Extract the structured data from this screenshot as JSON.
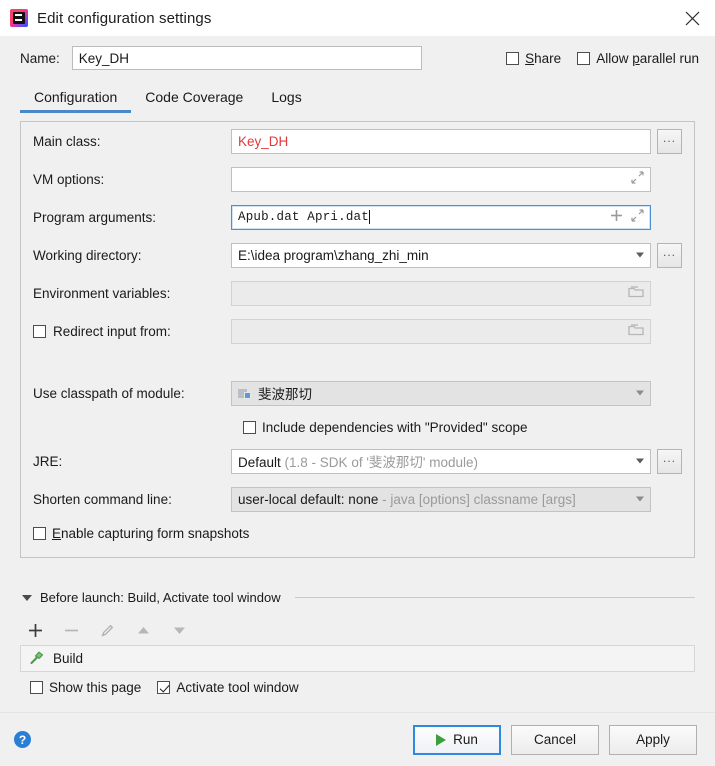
{
  "window": {
    "title": "Edit configuration settings",
    "app_icon": "intellij-idea-icon",
    "close_icon": "close-icon"
  },
  "header": {
    "name_label": "Name:",
    "name_value": "Key_DH",
    "name_placeholder": "",
    "share_label": "Share",
    "share_checked": false,
    "parallel_label": "Allow parallel run",
    "parallel_checked": false
  },
  "tabs": [
    {
      "label": "Configuration",
      "active": true
    },
    {
      "label": "Code Coverage",
      "active": false
    },
    {
      "label": "Logs",
      "active": false
    }
  ],
  "form": {
    "main_class": {
      "label": "Main class:",
      "value": "Key_DH",
      "error": true,
      "browse_label": "..."
    },
    "vm_options": {
      "label": "VM options:",
      "value": "",
      "expand_icon": "expand-icon"
    },
    "program_arguments": {
      "label": "Program arguments:",
      "value": "Apub.dat Apri.dat",
      "focused": true,
      "add_icon": "plus-icon",
      "expand_icon": "expand-icon"
    },
    "working_directory": {
      "label": "Working directory:",
      "value": "E:\\idea program\\zhang_zhi_min",
      "browse_label": "..."
    },
    "environment_variables": {
      "label": "Environment variables:",
      "value": "",
      "browse_icon": "folder-icon"
    },
    "redirect_input": {
      "label": "Redirect input from:",
      "checked": false,
      "value": "",
      "browse_icon": "folder-icon"
    },
    "use_classpath": {
      "label": "Use classpath of module:",
      "value": "斐波那切",
      "module_icon": "module-icon"
    },
    "include_provided": {
      "label": "Include dependencies with \"Provided\" scope",
      "checked": false
    },
    "jre": {
      "label": "JRE:",
      "value": "Default",
      "hint": "(1.8 - SDK of '斐波那切' module)",
      "browse_label": "..."
    },
    "shorten_command_line": {
      "label": "Shorten command line:",
      "value": "user-local default: none",
      "hint": "- java [options] classname [args]"
    },
    "form_snapshots": {
      "label": "Enable capturing form snapshots",
      "mnemonic": "E",
      "checked": false
    }
  },
  "before_launch": {
    "title": "Before launch: Build, Activate tool window",
    "collapse_icon": "triangle-down-icon",
    "toolbar": [
      {
        "name": "add-icon",
        "glyph": "+",
        "enabled": true
      },
      {
        "name": "remove-icon",
        "glyph": "−",
        "enabled": false
      },
      {
        "name": "edit-pencil-icon",
        "glyph": "pencil",
        "enabled": false
      },
      {
        "name": "move-up-icon",
        "glyph": "up",
        "enabled": false
      },
      {
        "name": "move-down-icon",
        "glyph": "down",
        "enabled": false
      }
    ],
    "items": [
      {
        "label": "Build",
        "icon": "hammer-icon"
      }
    ],
    "show_page_label": "Show this page",
    "show_page_checked": false,
    "activate_window_label": "Activate tool window",
    "activate_window_checked": true
  },
  "footer": {
    "help_icon": "help-icon",
    "help_glyph": "?",
    "run_label": "Run",
    "run_icon": "play-icon",
    "cancel_label": "Cancel",
    "apply_label": "Apply"
  },
  "colors": {
    "accent": "#4a88c7",
    "error_text": "#e03a3a",
    "focus_border": "#2d8ae0",
    "run_green": "#3d9e3d",
    "help_blue": "#2a7fd4"
  }
}
